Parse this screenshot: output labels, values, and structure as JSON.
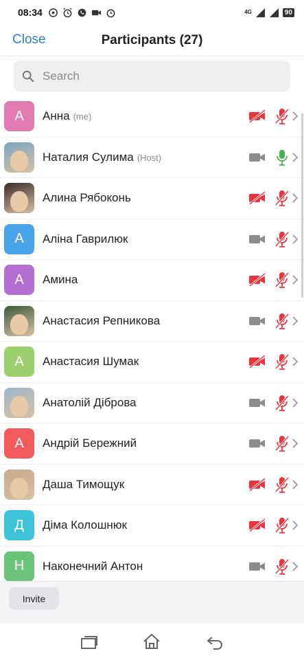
{
  "status_bar": {
    "time": "08:34",
    "network_label": "4G",
    "battery": "90"
  },
  "header": {
    "close_label": "Close",
    "title": "Participants (27)"
  },
  "search": {
    "placeholder": "Search"
  },
  "colors": {
    "accent": "#2d7ecb",
    "muted_red": "#e8353d",
    "mic_on_green": "#4caf50",
    "video_on_gray": "#8c8c8c"
  },
  "participants": [
    {
      "name": "Анна",
      "tag": "(me)",
      "initial": "А",
      "avatar_color": "#e07ab0",
      "video_muted": true,
      "mic_muted": true
    },
    {
      "name": "Наталия Сулима",
      "tag": "(Host)",
      "initial": "",
      "avatar_color": "#7aa6c2",
      "video_muted": false,
      "mic_muted": false
    },
    {
      "name": "Алина Рябоконь",
      "tag": "",
      "initial": "",
      "avatar_color": "#3a2a2a",
      "video_muted": true,
      "mic_muted": true
    },
    {
      "name": "Аліна Гаврилюк",
      "tag": "",
      "initial": "А",
      "avatar_color": "#4aa3e6",
      "video_muted": false,
      "mic_muted": true
    },
    {
      "name": "Амина",
      "tag": "",
      "initial": "А",
      "avatar_color": "#b46fd3",
      "video_muted": true,
      "mic_muted": true
    },
    {
      "name": "Анастасия Репникова",
      "tag": "",
      "initial": "",
      "avatar_color": "#3e5a3a",
      "video_muted": false,
      "mic_muted": true
    },
    {
      "name": "Анастасия Шумак",
      "tag": "",
      "initial": "А",
      "avatar_color": "#9cd06e",
      "video_muted": true,
      "mic_muted": true
    },
    {
      "name": "Анатолій Діброва",
      "tag": "",
      "initial": "",
      "avatar_color": "#9fb7c9",
      "video_muted": false,
      "mic_muted": true
    },
    {
      "name": "Андрій Бережний",
      "tag": "",
      "initial": "А",
      "avatar_color": "#f15b5b",
      "video_muted": false,
      "mic_muted": true
    },
    {
      "name": "Даша Тимощук",
      "tag": "",
      "initial": "",
      "avatar_color": "#c9a98e",
      "video_muted": true,
      "mic_muted": true
    },
    {
      "name": "Діма Колошнюк",
      "tag": "",
      "initial": "Д",
      "avatar_color": "#3fc3d9",
      "video_muted": true,
      "mic_muted": true
    },
    {
      "name": "Наконечний Антон",
      "tag": "",
      "initial": "Н",
      "avatar_color": "#6cc47a",
      "video_muted": false,
      "mic_muted": true
    }
  ],
  "footer": {
    "invite_label": "Invite"
  }
}
